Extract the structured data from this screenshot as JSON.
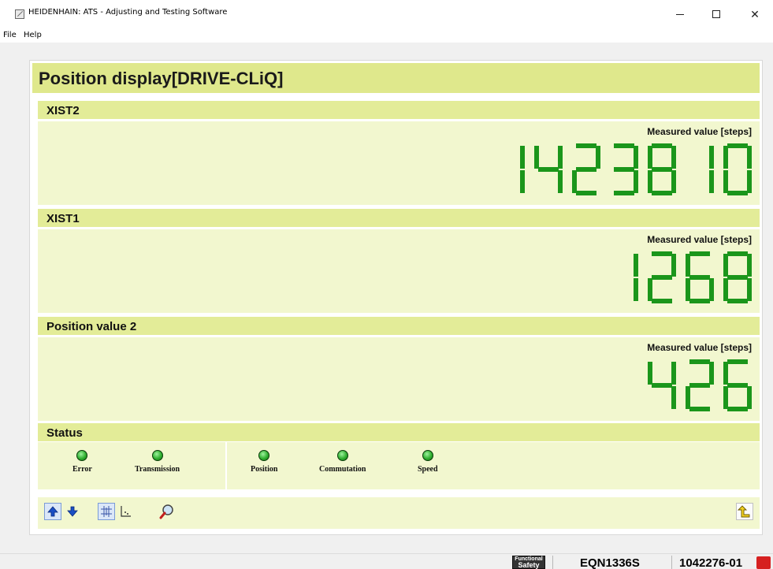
{
  "window": {
    "title": "HEIDENHAIN: ATS - Adjusting and Testing Software",
    "minimize_icon": "minimize-icon",
    "maximize_icon": "maximize-icon",
    "close_icon": "close-icon",
    "close_glyph": "✕"
  },
  "menu": {
    "file": "File",
    "help": "Help"
  },
  "panel": {
    "title": "Position display[DRIVE-CLiQ]",
    "sections": [
      {
        "label": "XIST2",
        "measure_label": "Measured value [steps]",
        "value": "1423810"
      },
      {
        "label": "XIST1",
        "measure_label": "Measured value [steps]",
        "value": "1268"
      },
      {
        "label": "Position value 2",
        "measure_label": "Measured value [steps]",
        "value": "426"
      }
    ],
    "display_color": "#1b961b",
    "status": {
      "label": "Status",
      "indicators": [
        {
          "label": "Error",
          "state": "green"
        },
        {
          "label": "Transmission",
          "state": "green"
        },
        {
          "label": "Position",
          "state": "green"
        },
        {
          "label": "Commutation",
          "state": "green"
        },
        {
          "label": "Speed",
          "state": "green"
        }
      ]
    },
    "toolbar": {
      "buttons": [
        {
          "icon": "arrow-up-icon",
          "selected": true
        },
        {
          "icon": "arrow-down-icon",
          "selected": false
        },
        {
          "icon": "grid-icon",
          "selected": true
        },
        {
          "icon": "axis-chart-icon",
          "selected": false
        },
        {
          "icon": "magnifier-icon",
          "selected": false
        },
        {
          "icon": "exit-return-icon",
          "selected": false
        }
      ]
    }
  },
  "statusbar": {
    "badge_line1": "Functional",
    "badge_line2": "Safety",
    "encoder_type": "EQN1336S",
    "id_number": "1042276-01"
  }
}
